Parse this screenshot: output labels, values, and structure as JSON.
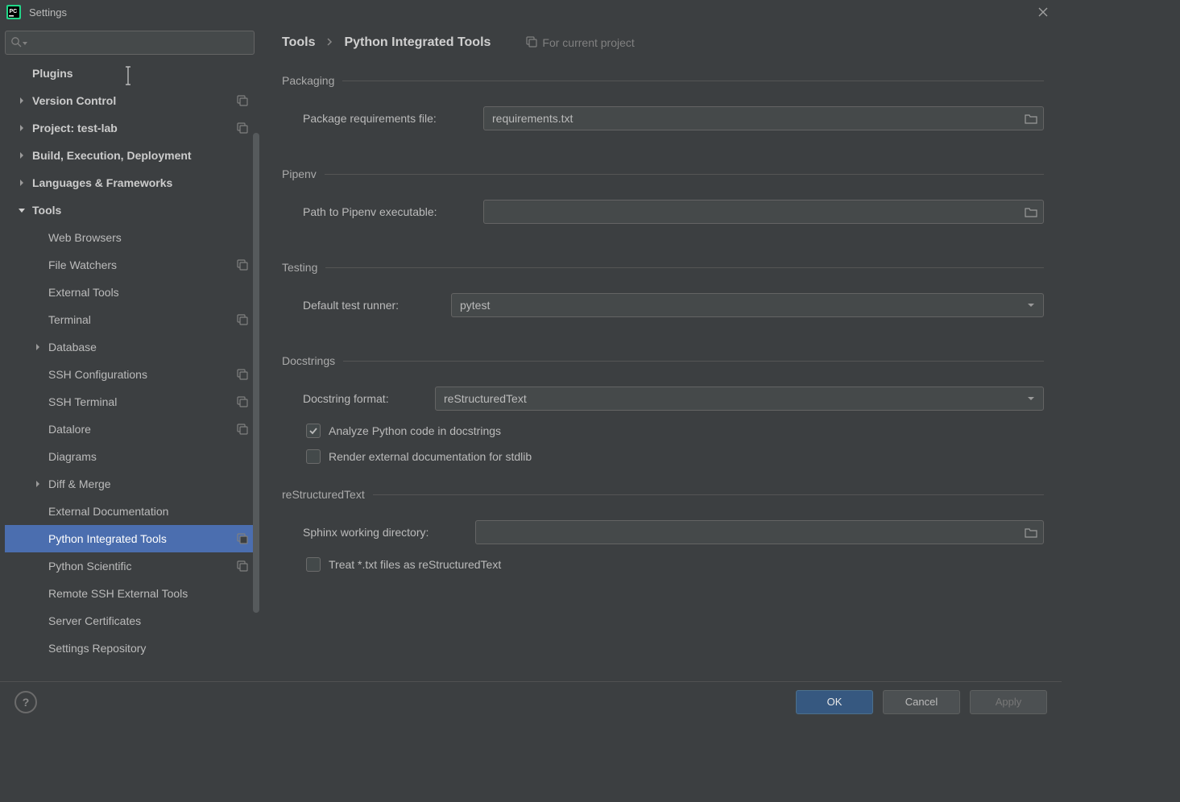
{
  "window": {
    "title": "Settings"
  },
  "search": {
    "placeholder": ""
  },
  "sidebar": {
    "items": [
      {
        "label": "Plugins",
        "bold": true,
        "level": 0,
        "arrow": "none",
        "badge": false
      },
      {
        "label": "Version Control",
        "bold": true,
        "level": 0,
        "arrow": "right",
        "badge": true
      },
      {
        "label": "Project: test-lab",
        "bold": true,
        "level": 0,
        "arrow": "right",
        "badge": true
      },
      {
        "label": "Build, Execution, Deployment",
        "bold": true,
        "level": 0,
        "arrow": "right",
        "badge": false
      },
      {
        "label": "Languages & Frameworks",
        "bold": true,
        "level": 0,
        "arrow": "right",
        "badge": false
      },
      {
        "label": "Tools",
        "bold": true,
        "level": 0,
        "arrow": "down",
        "badge": false
      },
      {
        "label": "Web Browsers",
        "level": 1,
        "arrow": "none",
        "badge": false
      },
      {
        "label": "File Watchers",
        "level": 1,
        "arrow": "none",
        "badge": true
      },
      {
        "label": "External Tools",
        "level": 1,
        "arrow": "none",
        "badge": false
      },
      {
        "label": "Terminal",
        "level": 1,
        "arrow": "none",
        "badge": true
      },
      {
        "label": "Database",
        "level": 1,
        "arrow": "right",
        "badge": false
      },
      {
        "label": "SSH Configurations",
        "level": 1,
        "arrow": "none",
        "badge": true
      },
      {
        "label": "SSH Terminal",
        "level": 1,
        "arrow": "none",
        "badge": true
      },
      {
        "label": "Datalore",
        "level": 1,
        "arrow": "none",
        "badge": true
      },
      {
        "label": "Diagrams",
        "level": 1,
        "arrow": "none",
        "badge": false
      },
      {
        "label": "Diff & Merge",
        "level": 1,
        "arrow": "right",
        "badge": false
      },
      {
        "label": "External Documentation",
        "level": 1,
        "arrow": "none",
        "badge": false
      },
      {
        "label": "Python Integrated Tools",
        "level": 1,
        "arrow": "none",
        "badge": true,
        "selected": true
      },
      {
        "label": "Python Scientific",
        "level": 1,
        "arrow": "none",
        "badge": true
      },
      {
        "label": "Remote SSH External Tools",
        "level": 1,
        "arrow": "none",
        "badge": false
      },
      {
        "label": "Server Certificates",
        "level": 1,
        "arrow": "none",
        "badge": false
      },
      {
        "label": "Settings Repository",
        "level": 1,
        "arrow": "none",
        "badge": false
      }
    ]
  },
  "breadcrumb": {
    "root": "Tools",
    "page": "Python Integrated Tools",
    "hint": "For current project"
  },
  "sections": {
    "packaging": {
      "legend": "Packaging",
      "req_label": "Package requirements file:",
      "req_value": "requirements.txt"
    },
    "pipenv": {
      "legend": "Pipenv",
      "path_label": "Path to Pipenv executable:",
      "path_value": ""
    },
    "testing": {
      "legend": "Testing",
      "runner_label": "Default test runner:",
      "runner_value": "pytest"
    },
    "docstrings": {
      "legend": "Docstrings",
      "format_label": "Docstring format:",
      "format_value": "reStructuredText",
      "cb_analyze": "Analyze Python code in docstrings",
      "cb_render": "Render external documentation for stdlib"
    },
    "rst": {
      "legend": "reStructuredText",
      "sphinx_label": "Sphinx working directory:",
      "sphinx_value": "",
      "cb_txt": "Treat *.txt files as reStructuredText"
    }
  },
  "footer": {
    "ok": "OK",
    "cancel": "Cancel",
    "apply": "Apply"
  }
}
